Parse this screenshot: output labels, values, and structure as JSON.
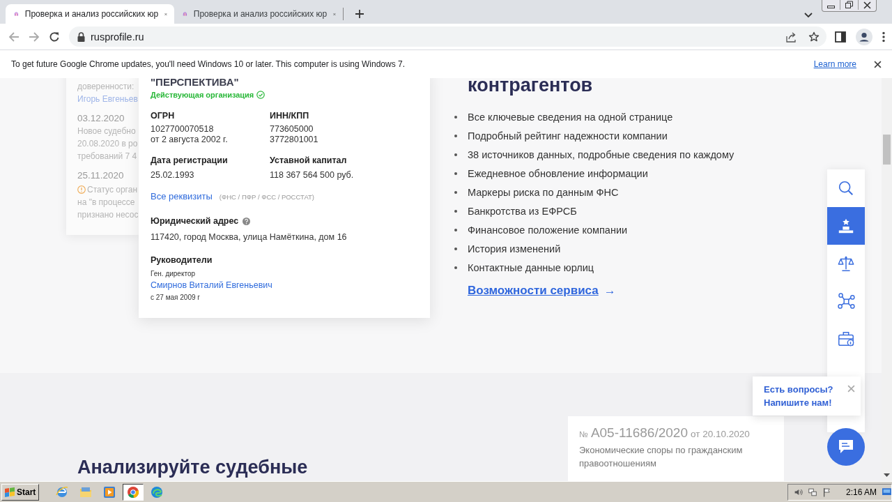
{
  "browser": {
    "tabs": [
      {
        "title": "Проверка и анализ российских юр",
        "selected": true
      },
      {
        "title": "Проверка и анализ российских юр",
        "selected": false
      }
    ],
    "address": "rusprofile.ru"
  },
  "infobar": {
    "message": "To get future Google Chrome updates, you'll need Windows 10 or later. This computer is using Windows 7.",
    "link": "Learn more"
  },
  "event_card": {
    "lines": [
      {
        "kind": "text",
        "text": "доверенности:"
      },
      {
        "kind": "link",
        "text": "Игорь Евгеньев"
      },
      {
        "kind": "date",
        "text": "03.12.2020"
      },
      {
        "kind": "text",
        "text": "Новое судебно"
      },
      {
        "kind": "text",
        "text": "20.08.2020 в ро"
      },
      {
        "kind": "text",
        "text": "требований 7 4"
      },
      {
        "kind": "date",
        "text": "25.11.2020"
      },
      {
        "kind": "warning",
        "text": "Статус орган"
      },
      {
        "kind": "text",
        "text": "на \"в процессе"
      },
      {
        "kind": "text",
        "text": "признано несос"
      }
    ]
  },
  "company_card": {
    "name": "\"ПЕРСПЕКТИВА\"",
    "status": "Действующая организация",
    "fields": [
      {
        "label": "ОГРН",
        "values": [
          "1027700070518",
          "от 2 августа 2002 г."
        ]
      },
      {
        "label": "ИНН/КПП",
        "values": [
          "773605000",
          "3772801001"
        ]
      },
      {
        "label": "Дата регистрации",
        "values": [
          "25.02.1993"
        ]
      },
      {
        "label": "Уставной капитал",
        "values": [
          "118 367 564 500 руб."
        ]
      }
    ],
    "requisites_link": "Все реквизиты",
    "requisites_sources": "(ФНС / ПФР / ФСС / РОССТАТ)",
    "address_label": "Юридический адрес",
    "address": "117420, город Москва, улица Намёткина, дом 16",
    "managers_label": "Руководители",
    "manager_role": "Ген. директор",
    "manager_name": "Смирнов Виталий Евгеньевич",
    "manager_since": "с 27 мая 2009 г"
  },
  "features": {
    "heading": "контрагентов",
    "items": [
      "Все ключевые сведения на одной странице",
      "Подробный рейтинг надежности компании",
      "38 источников данных, подробные сведения по каждому",
      "Ежедневное обновление информации",
      "Маркеры риска по данным ФНС",
      "Банкротства из ЕФРСБ",
      "Финансовое положение компании",
      "История изменений",
      "Контактные данные юрлиц"
    ],
    "link": "Возможности сервиса",
    "link_arrow": "→"
  },
  "side_dock": {
    "items": [
      {
        "kind": "search",
        "selected": false
      },
      {
        "kind": "podium",
        "selected": true
      },
      {
        "kind": "scales",
        "selected": false
      },
      {
        "kind": "nodes",
        "selected": false
      },
      {
        "kind": "briefcase",
        "selected": false
      }
    ]
  },
  "chat_popup": {
    "lines": [
      "Есть вопросы?",
      "Напишите нам!"
    ]
  },
  "court_section": {
    "heading": "Анализируйте судебные",
    "case": {
      "number_prefix": "№",
      "number": "А05-11686/2020",
      "date": "от 20.10.2020",
      "category": "Экономические споры по гражданским правоотношениям"
    }
  },
  "taskbar": {
    "start": "Start",
    "apps": [
      {
        "kind": "ie",
        "selected": false
      },
      {
        "kind": "folder",
        "selected": false
      },
      {
        "kind": "media",
        "selected": false
      },
      {
        "kind": "chrome",
        "selected": true
      },
      {
        "kind": "edge",
        "selected": false
      }
    ],
    "clock": "2:16 AM"
  }
}
